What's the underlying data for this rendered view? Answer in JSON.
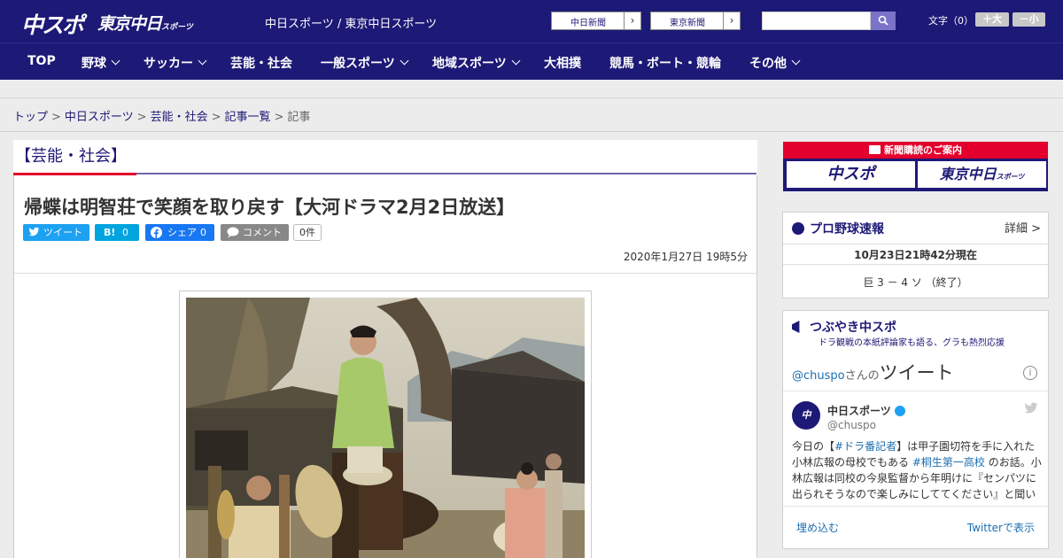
{
  "header": {
    "logo_main": "中スポ",
    "logo_tokyo": "東京中日",
    "logo_tokyo_small": "スポーツ",
    "site_links": "中日スポーツ / 東京中日スポーツ",
    "ext_links": [
      {
        "label": "中日新聞",
        "arrow": "›"
      },
      {
        "label": "東京新聞",
        "arrow": "›"
      }
    ],
    "search": {
      "placeholder": ""
    },
    "font_size_label": "文字（0）",
    "font_larger": "＋大",
    "font_smaller": "－小"
  },
  "nav": {
    "items": [
      {
        "label": "TOP",
        "has_dropdown": false
      },
      {
        "label": "野球",
        "has_dropdown": true
      },
      {
        "label": "サッカー",
        "has_dropdown": true
      },
      {
        "label": "芸能・社会",
        "has_dropdown": false
      },
      {
        "label": "一般スポーツ",
        "has_dropdown": true
      },
      {
        "label": "地域スポーツ",
        "has_dropdown": true
      },
      {
        "label": "大相撲",
        "has_dropdown": false
      },
      {
        "label": "競馬・ボート・競輪",
        "has_dropdown": false
      },
      {
        "label": "その他",
        "has_dropdown": true
      }
    ]
  },
  "breadcrumb": {
    "items": [
      "トップ",
      "中日スポーツ",
      "芸能・社会",
      "記事一覧"
    ],
    "current": "記事",
    "separator": ">"
  },
  "article": {
    "category": "【芸能・社会】",
    "title": "帰蝶は明智荘で笑顔を取り戻す【大河ドラマ2月2日放送】",
    "share": {
      "tweet": "ツイート",
      "hatena_icon": "B!",
      "hatena_count": "0",
      "facebook": "シェア",
      "facebook_count": "0",
      "comment": "コメント",
      "comment_count": "0件"
    },
    "date": "2020年1月27日 19時5分"
  },
  "sidebar": {
    "ad": {
      "title": "新聞購読のご案内",
      "logo_left": "中スポ",
      "logo_right": "東京中日",
      "logo_right_small": "スポーツ"
    },
    "baseball": {
      "title": "プロ野球速報",
      "detail": "詳細 >",
      "time": "10月23日21時42分現在",
      "score": "巨 3 － 4 ソ （終了）"
    },
    "tweets": {
      "title": "つぶやき中スポ",
      "subtitle": "ドラ観戦の本紙評論家も語る、グラも熱烈応援",
      "handle": "@chuspo",
      "handle_suffix": "さんの",
      "heading": "ツイート",
      "user_name": "中日スポーツ",
      "user_handle": "@chuspo",
      "text_1": "今日の【",
      "tag_1": "#ドラ番記者",
      "text_2": "】は甲子園切符を手に入れた",
      "line_2a": "小林広報の母校でもある ",
      "tag_2": "#桐生第一高校",
      "line_2b": " のお話。小",
      "line_3": "林広報は同校の今泉監督から年明けに『センパツに",
      "line_4": "出られそうなので楽しみにしててください』と聞い",
      "embed": "埋め込む",
      "view_on_twitter": "Twitterで表示"
    }
  },
  "colors": {
    "brand_navy": "#1d1976",
    "accent_red": "#e3002c",
    "twitter": "#1da1f2",
    "facebook": "#1877f2",
    "hatena": "#00a4de"
  }
}
